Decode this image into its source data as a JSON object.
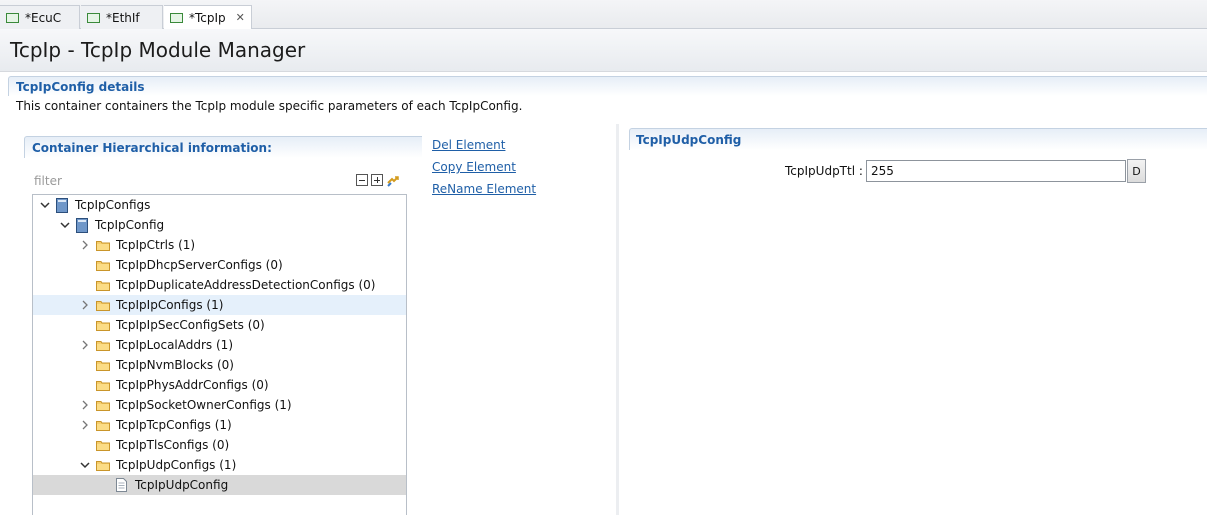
{
  "tabs": [
    {
      "label": "*EcuC",
      "active": false
    },
    {
      "label": "*EthIf",
      "active": false
    },
    {
      "label": "*TcpIp",
      "active": true
    }
  ],
  "title": "TcpIp - TcpIp Module Manager",
  "details": {
    "heading": "TcpIpConfig details",
    "description": "This container containers the TcpIp module specific parameters of each TcpIpConfig."
  },
  "hierarchy": {
    "heading": "Container Hierarchical information:",
    "filter_placeholder": "filter",
    "items": [
      {
        "label": "TcpIpConfigs",
        "depth": 0,
        "twisty": "expanded",
        "icon": "module-icon"
      },
      {
        "label": "TcpIpConfig",
        "depth": 1,
        "twisty": "expanded",
        "icon": "module-icon"
      },
      {
        "label": "TcpIpCtrls (1)",
        "depth": 2,
        "twisty": "collapsed",
        "icon": "folder-icon"
      },
      {
        "label": "TcpIpDhcpServerConfigs (0)",
        "depth": 2,
        "twisty": "none",
        "icon": "folder-icon"
      },
      {
        "label": "TcpIpDuplicateAddressDetectionConfigs (0)",
        "depth": 2,
        "twisty": "none",
        "icon": "folder-icon"
      },
      {
        "label": "TcpIpIpConfigs (1)",
        "depth": 2,
        "twisty": "collapsed",
        "icon": "folder-icon",
        "state": "hover"
      },
      {
        "label": "TcpIpIpSecConfigSets (0)",
        "depth": 2,
        "twisty": "none",
        "icon": "folder-icon"
      },
      {
        "label": "TcpIpLocalAddrs (1)",
        "depth": 2,
        "twisty": "collapsed",
        "icon": "folder-icon"
      },
      {
        "label": "TcpIpNvmBlocks (0)",
        "depth": 2,
        "twisty": "none",
        "icon": "folder-icon"
      },
      {
        "label": "TcpIpPhysAddrConfigs (0)",
        "depth": 2,
        "twisty": "none",
        "icon": "folder-icon"
      },
      {
        "label": "TcpIpSocketOwnerConfigs (1)",
        "depth": 2,
        "twisty": "collapsed",
        "icon": "folder-icon"
      },
      {
        "label": "TcpIpTcpConfigs (1)",
        "depth": 2,
        "twisty": "collapsed",
        "icon": "folder-icon"
      },
      {
        "label": "TcpIpTlsConfigs (0)",
        "depth": 2,
        "twisty": "none",
        "icon": "folder-icon"
      },
      {
        "label": "TcpIpUdpConfigs (1)",
        "depth": 2,
        "twisty": "expanded",
        "icon": "folder-icon"
      },
      {
        "label": "TcpIpUdpConfig",
        "depth": 3,
        "twisty": "none",
        "icon": "document-icon",
        "state": "selected"
      }
    ]
  },
  "actions": {
    "del": "Del Element",
    "copy": "Copy Element",
    "rename": "ReName Element"
  },
  "udp_config": {
    "heading": "TcpIpUdpConfig",
    "field_label": "TcpIpUdpTtl :",
    "field_value": "255",
    "default_button": "D"
  },
  "colors": {
    "section_heading": "#1f5fa7",
    "hover_row": "#e5f0fb",
    "selected_row": "#d9d9d9",
    "folder": "#f2c45a"
  }
}
